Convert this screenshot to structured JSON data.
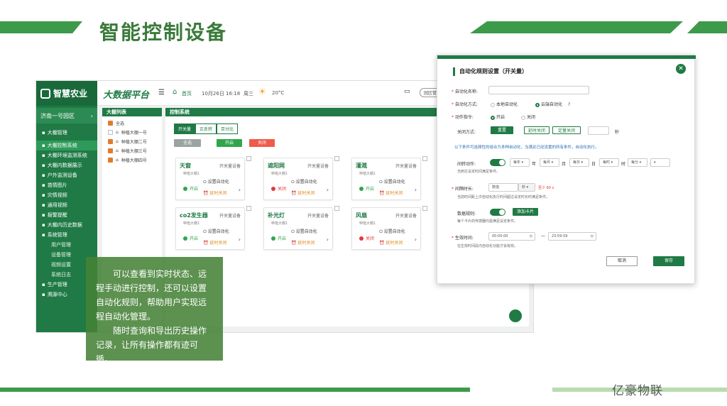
{
  "slide": {
    "title": "智能控制设备",
    "brand": "亿豪物联",
    "overlay_p1": "可以查看到实时状态、远程手动进行控制，还可以设置自动化规则，帮助用户实现远程自动化管理。",
    "overlay_p2": "随时查询和导出历史操作记录，让所有操作都有迹可循。"
  },
  "app": {
    "logo": "智慧农业",
    "platform": "大数据平台",
    "home": "首页",
    "date": "10月26日 16:18",
    "weekday": "周三",
    "temp": "20°C",
    "park_button": "园区管",
    "park": "济南一号园区",
    "sidebar": [
      {
        "label": "大棚管理",
        "sub": false
      },
      {
        "label": "大棚控制系统",
        "sub": false,
        "active": true
      },
      {
        "label": "大棚环境监测系统",
        "sub": false
      },
      {
        "label": "大棚内数据展示",
        "sub": false
      },
      {
        "label": "户外监测设备",
        "sub": false
      },
      {
        "label": "苗情图片",
        "sub": false
      },
      {
        "label": "灾情视频",
        "sub": false
      },
      {
        "label": "通用视频",
        "sub": false
      },
      {
        "label": "报警提醒",
        "sub": false
      },
      {
        "label": "大棚内历史数据",
        "sub": false
      },
      {
        "label": "系统管理",
        "sub": false
      },
      {
        "label": "用户管理",
        "sub": true
      },
      {
        "label": "设备管理",
        "sub": true
      },
      {
        "label": "视频设置",
        "sub": true
      },
      {
        "label": "系统日志",
        "sub": true
      },
      {
        "label": "生产管理",
        "sub": false
      },
      {
        "label": "溯源中心",
        "sub": false
      }
    ],
    "greenhouse_list_title": "大棚列表",
    "select_all": "全选",
    "greenhouses": [
      "种植大棚一号",
      "种植大棚二号",
      "种植大棚三号",
      "种植大棚四号"
    ],
    "control_title": "控制系统",
    "tabs": [
      "开关量",
      "正反转",
      "百分比"
    ],
    "btn_all": "全选",
    "btn_on": "开启",
    "btn_off": "关闭",
    "devices": [
      {
        "name": "天窗",
        "type": "开关量设备",
        "house": "种植大棚1",
        "status": "开启",
        "status_color": "#2fa64a",
        "auto": "设置自动化",
        "delay": "延时关闭"
      },
      {
        "name": "遮阳网",
        "type": "开关量设备",
        "house": "种植大棚1",
        "status": "关闭",
        "status_color": "#e03a3a",
        "auto": "设置自动化",
        "delay": "延时关闭"
      },
      {
        "name": "灌溉",
        "type": "开关量设备",
        "house": "种植大棚1",
        "status": "开启",
        "status_color": "#2fa64a",
        "auto": "设置自动化",
        "delay": "延时关闭"
      },
      {
        "name": "co2发生器",
        "type": "开关量设备",
        "house": "种植大棚1",
        "status": "开启",
        "status_color": "#2fa64a",
        "auto": "设置自动化",
        "delay": "延时关闭"
      },
      {
        "name": "补光灯",
        "type": "开关量设备",
        "house": "种植大棚1",
        "status": "开启",
        "status_color": "#2fa64a",
        "auto": "设置自动化",
        "delay": "延时关闭"
      },
      {
        "name": "风扇",
        "type": "开关量设备",
        "house": "种植大棚1",
        "status": "关闭",
        "status_color": "#e03a3a",
        "auto": "设置自动化",
        "delay": "延时关闭"
      }
    ]
  },
  "dialog": {
    "title": "自动化规则设置（开关量）",
    "name_label": "自动化名称:",
    "mode_label": "自动化方式:",
    "mode_local": "本地自动化",
    "mode_cloud": "云端自动化",
    "cmd_label": "动作指令:",
    "cmd_on": "开启",
    "cmd_off": "关闭",
    "close_mode_label": "关闭方式:",
    "close_reset": "重置",
    "close_delay": "延时关闭",
    "close_timed": "定量关闭",
    "seconds": "秒",
    "condition_note": "以下条件可选择性的组合为多种自动化，当满足已经设置的所有条件，自动化执行。",
    "interval_label": "间转动作:",
    "every_year": "每年",
    "year": "年",
    "every_month": "每月",
    "month": "月",
    "every_day": "每日",
    "day": "日",
    "every_hour": "每时",
    "hour": "时",
    "every_minute": "每分",
    "minute": "分",
    "interval_note": "当到达设定时间满足条件。",
    "duration_label": "间隔时长:",
    "duration_placeholder": "数值",
    "duration_unit": "秒",
    "duration_min": "至少 60 s",
    "duration_note": "当前时间距上次自动化执行时间超过设定时长时满足条件。",
    "data_rule_label": "数据规则:",
    "add_card": "添加卡片",
    "data_rule_note": "每个卡片的传感器均需满足设定条件。",
    "effective_label": "生效时间:",
    "time_start": "00:00:00",
    "time_end": "23:59:59",
    "effective_note": "在生效时间段内自动化功能才会有效。",
    "cancel": "取消",
    "save": "保存"
  }
}
